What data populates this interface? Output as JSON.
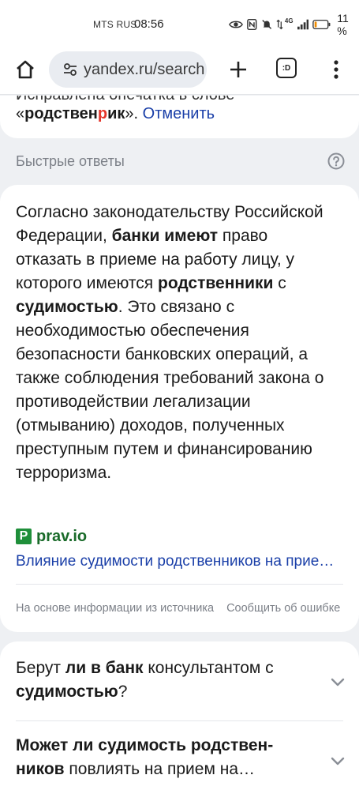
{
  "status_bar": {
    "carrier": "MTS RUS",
    "time": "08:56",
    "network": "4G",
    "battery": "11 %"
  },
  "browser": {
    "url": "yandex.ru/search",
    "tabs_badge": ":D"
  },
  "correction": {
    "top_text": "Исправлена опечатка в слове",
    "open_quote": "«",
    "word_before": "родствен",
    "word_highlight": "р",
    "word_after": "ик",
    "close_quote": "». ",
    "undo_label": "Отменить"
  },
  "quick_answers": {
    "section_title": "Быстрые ответы",
    "answer_parts": [
      {
        "text": "Согласно законодательству Российской Федерации, ",
        "bold": false
      },
      {
        "text": "банки имеют",
        "bold": true
      },
      {
        "text": " право отказать в приеме на работу лицу, у которого имеются ",
        "bold": false
      },
      {
        "text": "родственники",
        "bold": true
      },
      {
        "text": " с ",
        "bold": false
      },
      {
        "text": "судимостью",
        "bold": true
      },
      {
        "text": ". Это связано с необходимостью обеспечения безопасности банковских операций, а также соблюдения требований закона о противодействии легализации (отмыванию) доходов, полученных преступным путем и финансированию терроризма.",
        "bold": false
      }
    ],
    "source_logo": "P",
    "source_domain": "prav.io",
    "source_link": "Влияние судимости родственников на прием на работу в банк",
    "footer_note": "На основе информации из источника",
    "report_label": "Сообщить об ошибке"
  },
  "faq": {
    "items": [
      {
        "parts": [
          {
            "text": "Берут ",
            "bold": false
          },
          {
            "text": "ли в банк",
            "bold": true
          },
          {
            "text": " консультантом с ",
            "bold": false
          },
          {
            "text": "судимостью",
            "bold": true
          },
          {
            "text": "?",
            "bold": false
          }
        ]
      },
      {
        "parts": [
          {
            "text": "Может ли судимость родствен­ников",
            "bold": true
          },
          {
            "text": " повлиять на прием на…",
            "bold": false
          }
        ]
      }
    ]
  },
  "colors": {
    "accent_link": "#1a3fa8",
    "typo_highlight": "#e4352b",
    "source_green": "#1f8f3a",
    "page_bg": "#eef0f3"
  }
}
